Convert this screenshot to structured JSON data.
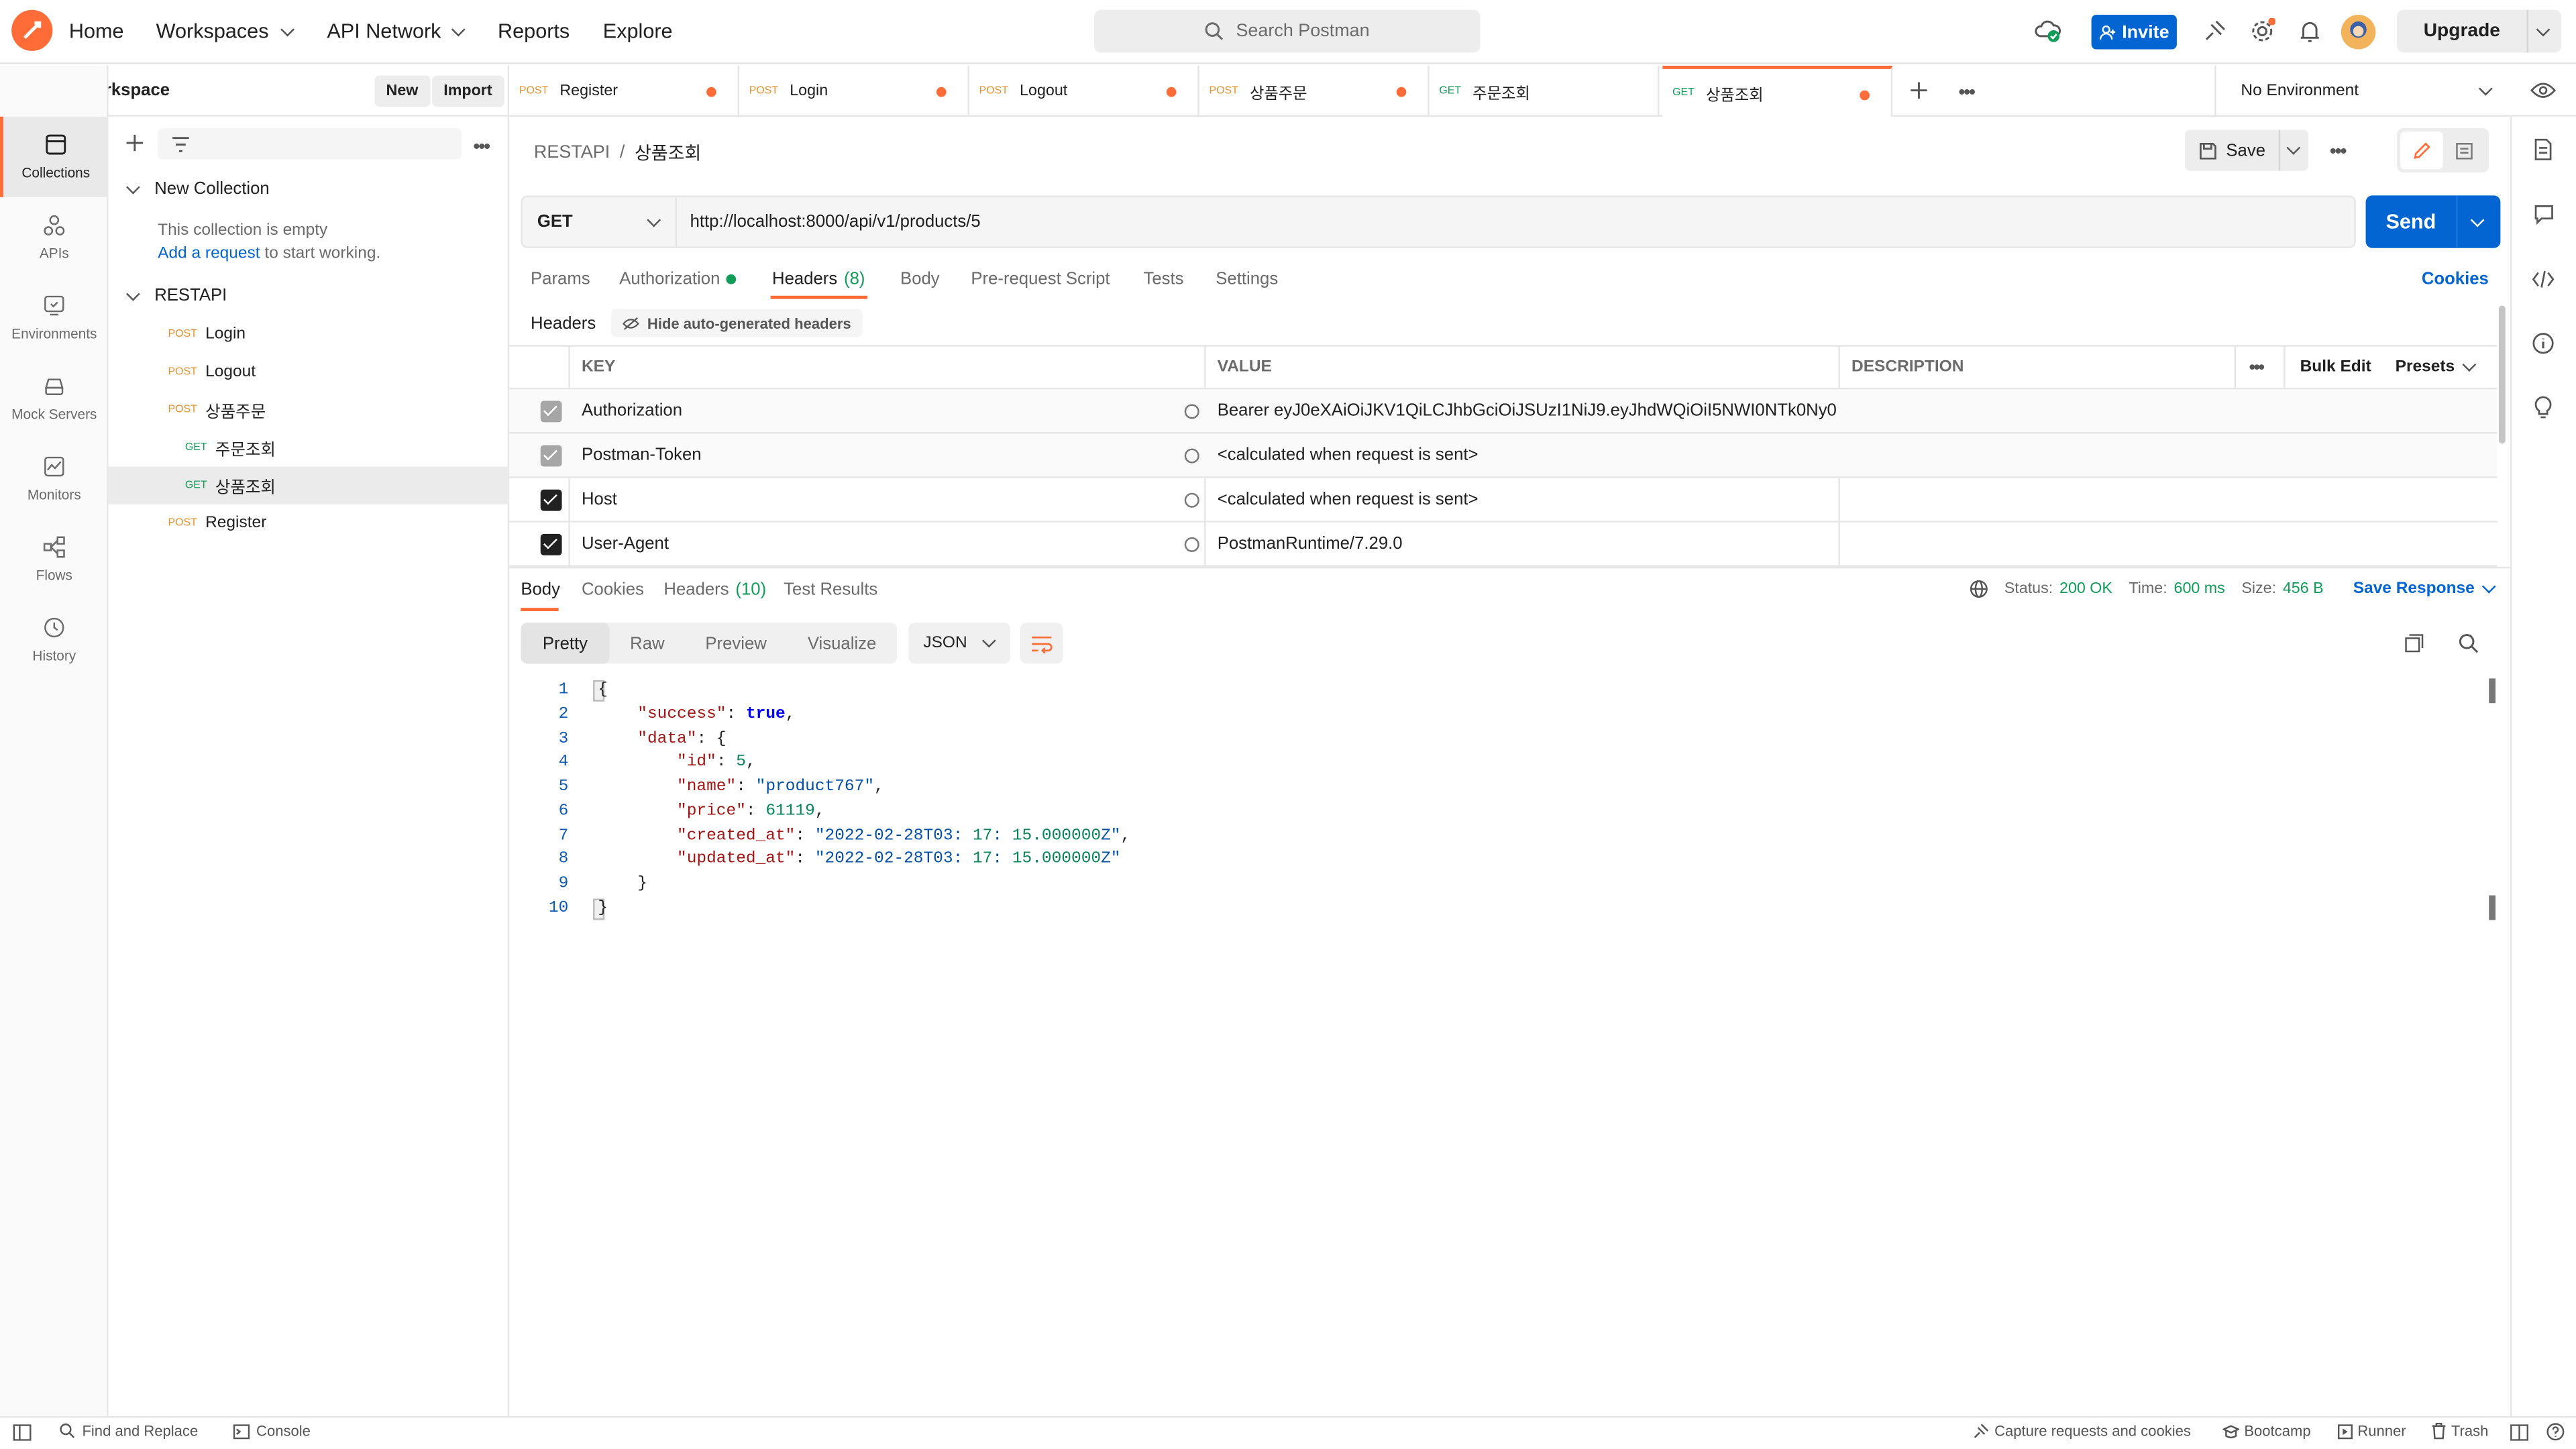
{
  "topbar": {
    "nav": [
      "Home",
      "Workspaces",
      "API Network",
      "Reports",
      "Explore"
    ],
    "search_placeholder": "Search Postman",
    "invite_label": "Invite",
    "upgrade_label": "Upgrade"
  },
  "workspace": {
    "title": "My Workspace",
    "new_label": "New",
    "import_label": "Import"
  },
  "rail": [
    "Collections",
    "APIs",
    "Environments",
    "Mock Servers",
    "Monitors",
    "Flows",
    "History"
  ],
  "sidebar": {
    "collection1": "New Collection",
    "empty_text": "This collection is empty",
    "add_request_link": "Add a request",
    "add_request_suffix": " to start working.",
    "collection2": "RESTAPI",
    "items": [
      {
        "method": "POST",
        "name": "Login"
      },
      {
        "method": "POST",
        "name": "Logout"
      },
      {
        "method": "POST",
        "name": "상품주문"
      },
      {
        "method": "GET",
        "name": "주문조회"
      },
      {
        "method": "GET",
        "name": "상품조회"
      },
      {
        "method": "POST",
        "name": "Register"
      }
    ]
  },
  "tabs": [
    {
      "method": "POST",
      "name": "Register"
    },
    {
      "method": "POST",
      "name": "Login"
    },
    {
      "method": "POST",
      "name": "Logout"
    },
    {
      "method": "POST",
      "name": "상품주문"
    },
    {
      "method": "GET",
      "name": "주문조회"
    },
    {
      "method": "GET",
      "name": "상품조회"
    }
  ],
  "environment": "No Environment",
  "request": {
    "breadcrumb_root": "RESTAPI",
    "breadcrumb_sep": "/",
    "breadcrumb_current": "상품조회",
    "save_label": "Save",
    "method": "GET",
    "url": "http://localhost:8000/api/v1/products/5",
    "send_label": "Send",
    "tabs": [
      "Params",
      "Authorization",
      "Headers",
      "Body",
      "Pre-request Script",
      "Tests",
      "Settings"
    ],
    "headers_count": "(8)",
    "cookies_label": "Cookies",
    "headers_label": "Headers",
    "hide_auto": "Hide auto-generated headers",
    "table_cols": [
      "KEY",
      "VALUE",
      "DESCRIPTION"
    ],
    "bulk_edit": "Bulk Edit",
    "presets": "Presets",
    "rows": [
      {
        "key": "Authorization",
        "value": "Bearer eyJ0eXAiOiJKV1QiLCJhbGciOiJSUzI1NiJ9.eyJhdWQiOiI5NWI0NTk0Ny0"
      },
      {
        "key": "Postman-Token",
        "value": "<calculated when request is sent>"
      },
      {
        "key": "Host",
        "value": "<calculated when request is sent>"
      },
      {
        "key": "User-Agent",
        "value": "PostmanRuntime/7.29.0"
      }
    ]
  },
  "response": {
    "tabs": [
      "Body",
      "Cookies",
      "Headers",
      "Test Results"
    ],
    "headers_count": "(10)",
    "status_label": "Status:",
    "status_value": "200 OK",
    "time_label": "Time:",
    "time_value": "600 ms",
    "size_label": "Size:",
    "size_value": "456 B",
    "save_response": "Save Response",
    "views": [
      "Pretty",
      "Raw",
      "Preview",
      "Visualize"
    ],
    "format": "JSON",
    "code_lines": [
      "{",
      "    \"success\": true,",
      "    \"data\": {",
      "        \"id\": 5,",
      "        \"name\": \"product767\",",
      "        \"price\": 61119,",
      "        \"created_at\": \"2022-02-28T03:17:15.000000Z\",",
      "        \"updated_at\": \"2022-02-28T03:17:15.000000Z\"",
      "    }",
      "}"
    ]
  },
  "statusbar": {
    "find_replace": "Find and Replace",
    "console": "Console",
    "capture": "Capture requests and cookies",
    "bootcamp": "Bootcamp",
    "runner": "Runner",
    "trash": "Trash"
  },
  "colors": {
    "accent": "#ff6c37",
    "primary": "#0265d2",
    "post": "#e5912d",
    "get": "#0f9d58"
  }
}
